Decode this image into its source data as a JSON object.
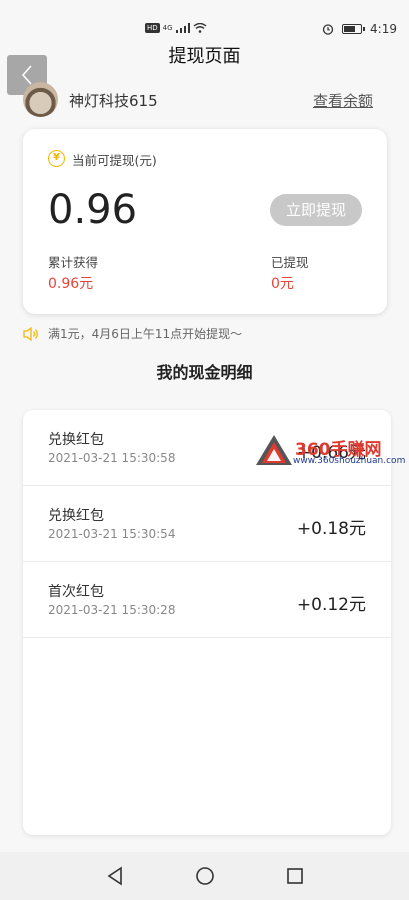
{
  "status_bar": {
    "network_badge": "HD",
    "network_type": "4G",
    "time": "4:19"
  },
  "header": {
    "title": "提现页面"
  },
  "account": {
    "name": "神灯科技615",
    "balance_link": "查看余额"
  },
  "balance_card": {
    "withdrawable_label": "当前可提现(元)",
    "withdrawable_amount": "0.96",
    "withdraw_button": "立即提现",
    "earned_label": "累计获得",
    "earned_value": "0.96元",
    "withdrawn_label": "已提现",
    "withdrawn_value": "0元"
  },
  "notice": {
    "text": "满1元，4月6日上午11点开始提现～"
  },
  "details": {
    "title": "我的现金明细",
    "records": [
      {
        "title": "兑换红包",
        "time": "2021-03-21 15:30:58",
        "amount": "+0.66元"
      },
      {
        "title": "兑换红包",
        "time": "2021-03-21 15:30:54",
        "amount": "+0.18元"
      },
      {
        "title": "首次红包",
        "time": "2021-03-21 15:30:28",
        "amount": "+0.12元"
      }
    ]
  },
  "watermark": {
    "text": "360手赚网",
    "url": "www.360shouzhuan.com"
  },
  "colors": {
    "accent_red": "#e4453b",
    "coin_yellow": "#f2b705",
    "button_gray": "#c8c8c8"
  }
}
